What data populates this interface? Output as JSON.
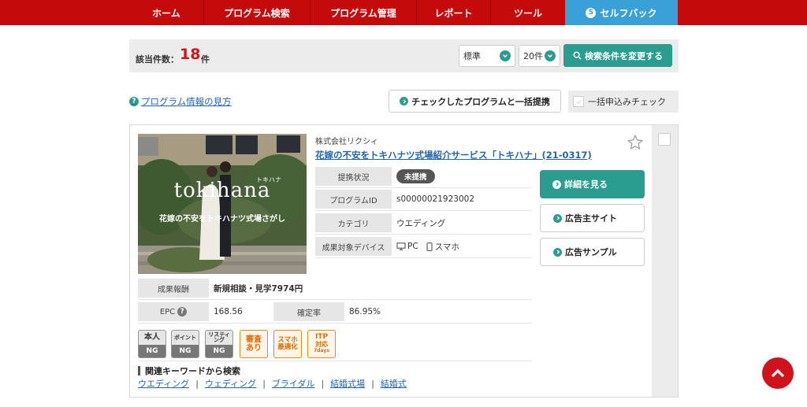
{
  "nav": {
    "items": [
      "ホーム",
      "プログラム検索",
      "プログラム管理",
      "レポート",
      "ツール"
    ],
    "selfback": "セルフバック",
    "selfback_icon": "S"
  },
  "search": {
    "count_label": "該当件数：",
    "count": "18",
    "count_unit": "件",
    "sort_value": "標準",
    "per_page_value": "20件",
    "change_button": "検索条件を変更する"
  },
  "help_link": "プログラム情報の見方",
  "help_icon": "?",
  "bulk_button": "チェックしたプログラムと一括提携",
  "bulk_check_label": "一括申込みチェック",
  "program": {
    "company": "株式会社リクシィ",
    "title": "花嫁の不安をトキハナツ式場紹介サービス「トキハナ」(21-0317)",
    "image": {
      "logo": "tokihana",
      "kana": "トキハナ",
      "caption": "花嫁の不安をトキハナツ式場さがし"
    },
    "status_label": "提携状況",
    "status": "未提携",
    "id_label": "プログラムID",
    "id": "s00000021923002",
    "category_label": "カテゴリ",
    "category": "ウエディング",
    "device_label": "成果対象デバイス",
    "device_pc": "PC",
    "device_sp": "スマホ",
    "reward_label": "成果報酬",
    "reward": "新規相談・見学7974円",
    "epc_label": "EPC",
    "epc": "168.56",
    "rate_label": "確定率",
    "rate": "86.95%",
    "actions": {
      "detail": "詳細を見る",
      "advertiser": "広告主サイト",
      "sample": "広告サンプル"
    },
    "badges": {
      "b1_top": "本人",
      "b1_bot": "NG",
      "b2_top": "ポイント",
      "b2_bot": "NG",
      "b3_top1": "リスティ",
      "b3_top2": "ング",
      "b3_bot": "NG",
      "b4_1": "審査",
      "b4_2": "あり",
      "b5_1": "スマホ",
      "b5_2": "最適化",
      "b6_1": "ITP",
      "b6_2": "対応",
      "b6_3": "7days"
    },
    "keywords_heading": "関連キーワードから検索",
    "keywords": [
      "ウエディング",
      "ウェディング",
      "ブライダル",
      "結婚式場",
      "結婚式"
    ],
    "keyword_separator": "|"
  },
  "colors": {
    "nav_bg": "#c40a0a",
    "selfback_bg": "#3aa0d8",
    "accent": "#2a9d8f",
    "count": "#d0121b",
    "link": "#2565ae",
    "badge_orange": "#e88a1a"
  }
}
